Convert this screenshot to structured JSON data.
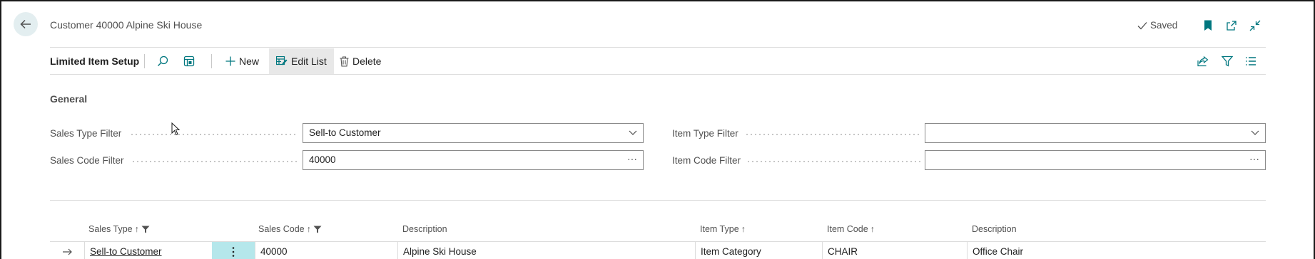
{
  "header": {
    "caption": "Customer 40000 Alpine Ski House",
    "saved_label": "Saved"
  },
  "actionbar": {
    "title": "Limited Item Setup",
    "new_label": "New",
    "edit_list_label": "Edit List",
    "delete_label": "Delete"
  },
  "general": {
    "title": "General",
    "sales_type_filter": {
      "label": "Sales Type Filter",
      "value": "Sell-to Customer"
    },
    "sales_code_filter": {
      "label": "Sales Code Filter",
      "value": "40000"
    },
    "item_type_filter": {
      "label": "Item Type Filter",
      "value": ""
    },
    "item_code_filter": {
      "label": "Item Code Filter",
      "value": ""
    }
  },
  "list": {
    "columns": {
      "sales_type": "Sales Type",
      "sales_code": "Sales Code",
      "description": "Description",
      "item_type": "Item Type",
      "item_code": "Item Code",
      "description2": "Description"
    },
    "rows": [
      {
        "sales_type": "Sell-to Customer",
        "sales_code": "40000",
        "description": "Alpine Ski House",
        "item_type": "Item Category",
        "item_code": "CHAIR",
        "description2": "Office Chair"
      }
    ]
  },
  "colors": {
    "accent": "#00777f",
    "row_menu_bg": "#b5e7eb"
  }
}
